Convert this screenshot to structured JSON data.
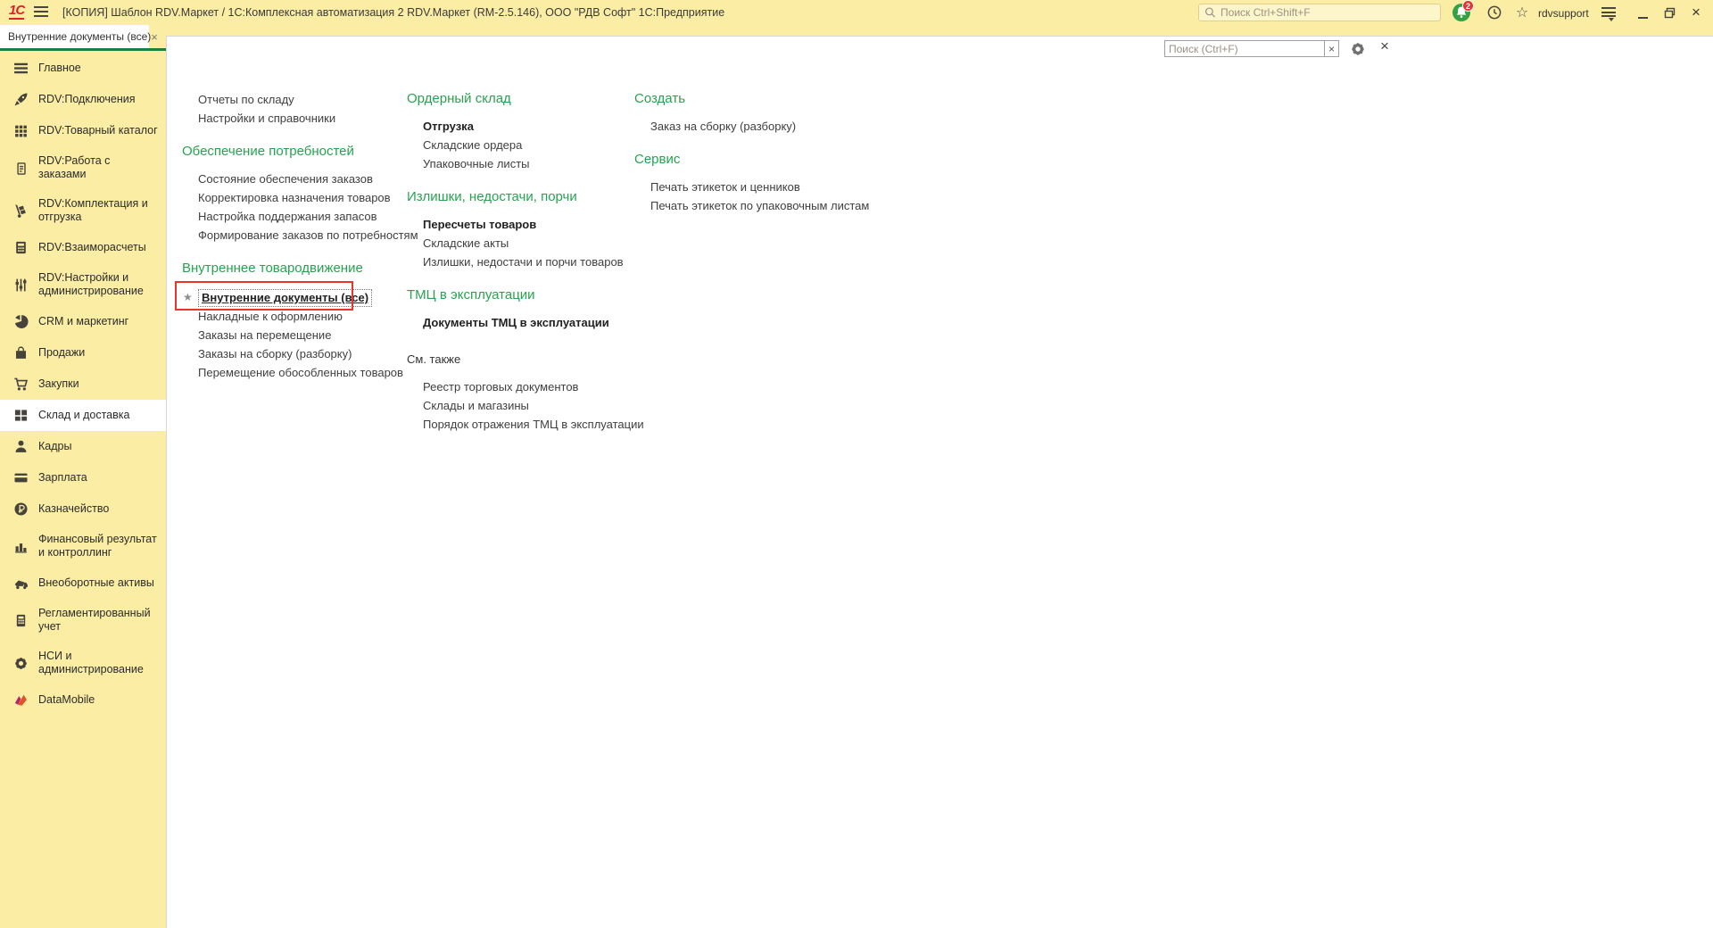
{
  "topbar": {
    "logo_text": "1С",
    "title": "[КОПИЯ] Шаблон RDV.Маркет / 1С:Комплексная автоматизация 2 RDV.Маркет (RM-2.5.146), ООО \"РДВ Софт\" 1С:Предприятие",
    "search_placeholder": "Поиск Ctrl+Shift+F",
    "notification_badge": "2",
    "username": "rdvsupport"
  },
  "tabs": [
    {
      "label": "Внутренние документы (все)"
    }
  ],
  "panel": {
    "search_placeholder": "Поиск (Ctrl+F)"
  },
  "glyphs": {
    "close": "×",
    "star": "★",
    "favorites_star": "☆"
  },
  "colors": {
    "accent_green": "#28a251",
    "bar_yellow": "#fbeda4",
    "highlight_red": "#e8352b",
    "logo_red": "#e31e24"
  },
  "sidebar": {
    "items": [
      {
        "label": "Главное",
        "icon": "hamburger-icon",
        "selected": false
      },
      {
        "label": "RDV:Подключения",
        "icon": "rocket-icon",
        "selected": false
      },
      {
        "label": "RDV:Товарный каталог",
        "icon": "catalog-grid-icon",
        "selected": false
      },
      {
        "label": "RDV:Работа с заказами",
        "icon": "orders-clipboard-icon",
        "selected": false
      },
      {
        "label": "RDV:Комплектация и отгрузка",
        "icon": "handtruck-icon",
        "selected": false
      },
      {
        "label": "RDV:Взаиморасчеты",
        "icon": "calculator-icon",
        "selected": false
      },
      {
        "label": "RDV:Настройки и администрирование",
        "icon": "sliders-icon",
        "selected": false
      },
      {
        "label": "CRM и маркетинг",
        "icon": "pie-chart-icon",
        "selected": false
      },
      {
        "label": "Продажи",
        "icon": "shopping-bag-icon",
        "selected": false
      },
      {
        "label": "Закупки",
        "icon": "cart-icon",
        "selected": false
      },
      {
        "label": "Склад и доставка",
        "icon": "warehouse-icon",
        "selected": true
      },
      {
        "label": "Кадры",
        "icon": "person-icon",
        "selected": false
      },
      {
        "label": "Зарплата",
        "icon": "card-icon",
        "selected": false
      },
      {
        "label": "Казначейство",
        "icon": "ruble-icon",
        "selected": false
      },
      {
        "label": "Финансовый результат и контроллинг",
        "icon": "bar-chart-icon",
        "selected": false
      },
      {
        "label": "Внеоборотные активы",
        "icon": "truck-icon",
        "selected": false
      },
      {
        "label": "Регламентированный учет",
        "icon": "ledger-icon",
        "selected": false
      },
      {
        "label": "НСИ и администрирование",
        "icon": "gear-icon",
        "selected": false
      },
      {
        "label": "DataMobile",
        "icon": "datamobile-icon",
        "selected": false
      }
    ]
  },
  "menu": {
    "columns": [
      {
        "groups": [
          {
            "header": null,
            "items": [
              {
                "label": "Отчеты по складу"
              },
              {
                "label": "Настройки и справочники"
              }
            ]
          },
          {
            "header": "Обеспечение потребностей",
            "items": [
              {
                "label": "Состояние обеспечения заказов"
              },
              {
                "label": "Корректировка назначения товаров"
              },
              {
                "label": "Настройка поддержания запасов"
              },
              {
                "label": "Формирование заказов по потребностям"
              }
            ]
          },
          {
            "header": "Внутреннее товародвижение",
            "items": [
              {
                "label": "Внутренние документы (все)",
                "starred": true,
                "highlighted": true,
                "bold": true
              },
              {
                "label": "Накладные к оформлению"
              },
              {
                "label": "Заказы на перемещение"
              },
              {
                "label": "Заказы на сборку (разборку)"
              },
              {
                "label": "Перемещение обособленных товаров"
              }
            ]
          }
        ]
      },
      {
        "groups": [
          {
            "header": "Ордерный склад",
            "items": [
              {
                "label": "Отгрузка",
                "bold": true
              },
              {
                "label": "Складские ордера"
              },
              {
                "label": "Упаковочные листы"
              }
            ]
          },
          {
            "header": "Излишки, недостачи, порчи",
            "items": [
              {
                "label": "Пересчеты товаров",
                "bold": true
              },
              {
                "label": "Складские акты"
              },
              {
                "label": "Излишки, недостачи и порчи товаров"
              }
            ]
          },
          {
            "header": "ТМЦ в эксплуатации",
            "items": [
              {
                "label": "Документы ТМЦ в эксплуатации",
                "bold": true
              }
            ]
          },
          {
            "header": "См. также",
            "see_also": true,
            "items": [
              {
                "label": "Реестр торговых документов"
              },
              {
                "label": "Склады и магазины"
              },
              {
                "label": "Порядок отражения ТМЦ в эксплуатации"
              }
            ]
          }
        ]
      },
      {
        "groups": [
          {
            "header": "Создать",
            "items": [
              {
                "label": "Заказ на сборку (разборку)"
              }
            ]
          },
          {
            "header": "Сервис",
            "items": [
              {
                "label": "Печать этикеток и ценников"
              },
              {
                "label": "Печать этикеток по упаковочным листам"
              }
            ]
          }
        ]
      }
    ]
  }
}
